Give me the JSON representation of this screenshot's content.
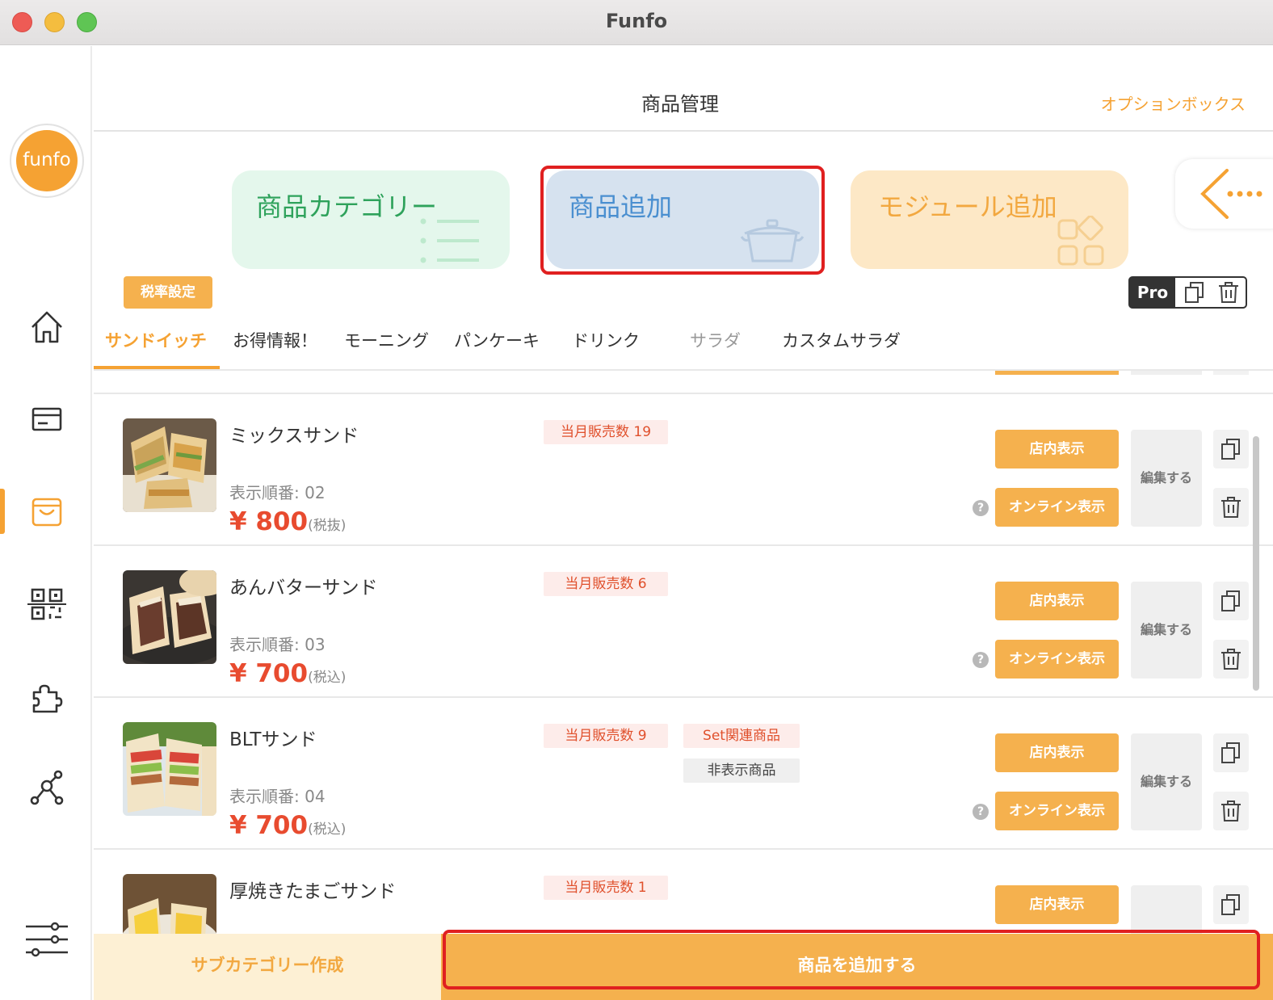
{
  "window": {
    "title": "Funfo"
  },
  "sidebar": {
    "logo_text": "funfo",
    "nav": [
      {
        "name": "home-icon"
      },
      {
        "name": "card-icon"
      },
      {
        "name": "shopping-bag-icon",
        "active": true
      },
      {
        "name": "qr-code-icon"
      },
      {
        "name": "puzzle-icon"
      },
      {
        "name": "network-icon"
      },
      {
        "name": "settings-sliders-icon"
      }
    ]
  },
  "header": {
    "title": "商品管理",
    "option_box": "オプションボックス"
  },
  "cards": {
    "category": "商品カテゴリー",
    "add_product": "商品追加",
    "add_module": "モジュール追加"
  },
  "toolbar": {
    "tax_setting": "税率設定",
    "pro_label": "Pro"
  },
  "tabs": [
    "サンドイッチ",
    "お得情報！",
    "モーニング",
    "パンケーキ",
    "ドリンク",
    "サラダ",
    "カスタムサラダ"
  ],
  "products": [
    {
      "name": "ミックスサンド",
      "sales": "当月販売数 19",
      "order": "表示順番: 02",
      "price": "¥ 800",
      "tax": "(税抜)",
      "set_badge": "",
      "hidden_badge": ""
    },
    {
      "name": "あんバターサンド",
      "sales": "当月販売数 6",
      "order": "表示順番: 03",
      "price": "¥ 700",
      "tax": "(税込)",
      "set_badge": "",
      "hidden_badge": ""
    },
    {
      "name": "BLTサンド",
      "sales": "当月販売数 9",
      "order": "表示順番: 04",
      "price": "¥ 700",
      "tax": "(税込)",
      "set_badge": "Set関連商品",
      "hidden_badge": "非表示商品"
    },
    {
      "name": "厚焼きたまごサンド",
      "sales": "当月販売数 1",
      "order": "",
      "price": "",
      "tax": "",
      "set_badge": "",
      "hidden_badge": ""
    }
  ],
  "row_actions": {
    "store_display": "店内表示",
    "online_display": "オンライン表示",
    "edit": "編集する",
    "help": "?"
  },
  "footer": {
    "create_subcategory": "サブカテゴリー作成",
    "add_product": "商品を追加する"
  },
  "colors": {
    "accent": "#f5a233",
    "price": "#e84b2f",
    "highlight": "#e02020"
  }
}
